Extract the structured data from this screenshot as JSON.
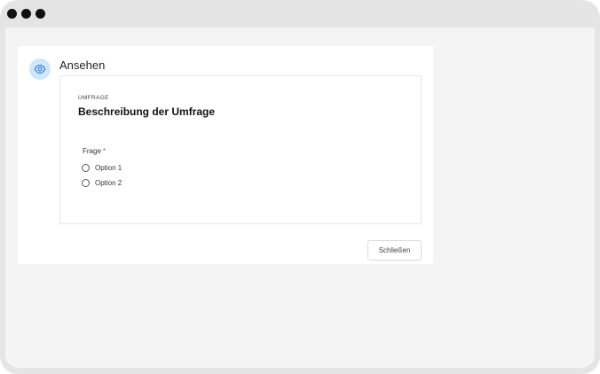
{
  "window": {
    "traffic_dots": 3
  },
  "dialog": {
    "title": "Ansehen",
    "icon": "eye-icon",
    "accent_color": "#2f80d8",
    "icon_background": "#cfe6fa"
  },
  "survey": {
    "kicker": "UMFRAGE",
    "heading": "Beschreibung der Umfrage",
    "question": {
      "label": "Frage",
      "required_marker": "*",
      "options": [
        {
          "label": "Option 1",
          "selected": false
        },
        {
          "label": "Option 2",
          "selected": false
        }
      ]
    }
  },
  "footer": {
    "close_label": "Schließen"
  }
}
